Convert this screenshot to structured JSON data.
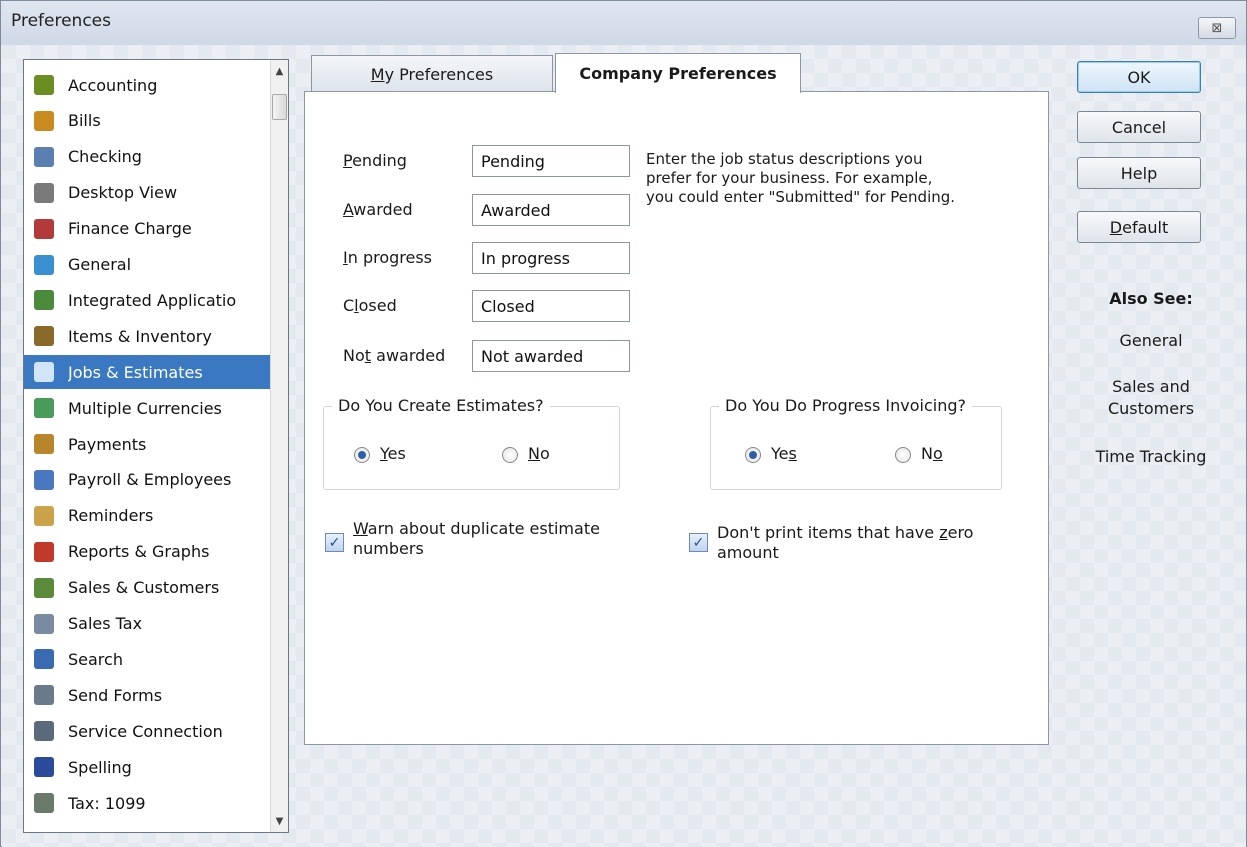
{
  "window": {
    "title": "Preferences",
    "close_glyph": "⊠"
  },
  "sidebar": {
    "items": [
      {
        "label": "Accounting",
        "icon": "accounting-icon",
        "color": "#6b8e23"
      },
      {
        "label": "Bills",
        "icon": "bills-icon",
        "color": "#c98a1e"
      },
      {
        "label": "Checking",
        "icon": "checking-icon",
        "color": "#5a7fb0"
      },
      {
        "label": "Desktop View",
        "icon": "desktop-view-icon",
        "color": "#7a7a7a"
      },
      {
        "label": "Finance Charge",
        "icon": "finance-charge-icon",
        "color": "#b33a3a"
      },
      {
        "label": "General",
        "icon": "general-icon",
        "color": "#3a8fd0"
      },
      {
        "label": "Integrated Applicatio",
        "icon": "integrated-applications-icon",
        "color": "#4a8a3a"
      },
      {
        "label": "Items & Inventory",
        "icon": "items-inventory-icon",
        "color": "#8a6a2a"
      },
      {
        "label": "Jobs & Estimates",
        "icon": "jobs-estimates-icon",
        "color": "#d2e4f7"
      },
      {
        "label": "Multiple Currencies",
        "icon": "multiple-currencies-icon",
        "color": "#4a9a5a"
      },
      {
        "label": "Payments",
        "icon": "payments-icon",
        "color": "#b8862a"
      },
      {
        "label": "Payroll & Employees",
        "icon": "payroll-employees-icon",
        "color": "#4a78c0"
      },
      {
        "label": "Reminders",
        "icon": "reminders-icon",
        "color": "#c9a24a"
      },
      {
        "label": "Reports & Graphs",
        "icon": "reports-graphs-icon",
        "color": "#c0392b"
      },
      {
        "label": "Sales & Customers",
        "icon": "sales-customers-icon",
        "color": "#5a8a3a"
      },
      {
        "label": "Sales Tax",
        "icon": "sales-tax-icon",
        "color": "#7a8aa0"
      },
      {
        "label": "Search",
        "icon": "search-icon",
        "color": "#3a6ab0"
      },
      {
        "label": "Send Forms",
        "icon": "send-forms-icon",
        "color": "#6a7a8a"
      },
      {
        "label": "Service Connection",
        "icon": "service-connection-icon",
        "color": "#5a6a7a"
      },
      {
        "label": "Spelling",
        "icon": "spelling-icon",
        "color": "#2a4a9a"
      },
      {
        "label": "Tax: 1099",
        "icon": "tax-1099-icon",
        "color": "#6a7a6a"
      }
    ],
    "selected_index": 8,
    "selected_color": "#3a78c2",
    "scroll_up": "▲",
    "scroll_down": "▼"
  },
  "tabs": {
    "my_preferences_underline": "M",
    "my_preferences_rest": "y Preferences",
    "company_preferences": "Company Preferences"
  },
  "status_fields": [
    {
      "label_pre": "",
      "label_u": "P",
      "label_post": "ending",
      "value": "Pending"
    },
    {
      "label_pre": "",
      "label_u": "A",
      "label_post": "warded",
      "value": "Awarded"
    },
    {
      "label_pre": "",
      "label_u": "I",
      "label_post": "n progress",
      "value": "In progress"
    },
    {
      "label_pre": "C",
      "label_u": "l",
      "label_post": "osed",
      "value": "Closed"
    },
    {
      "label_pre": "No",
      "label_u": "t",
      "label_post": " awarded",
      "value": "Not awarded"
    }
  ],
  "hint_lines": [
    "Enter the job status descriptions you",
    "prefer for your business.  For example,",
    "you could enter \"Submitted\" for Pending."
  ],
  "estimates_group": {
    "legend": "Do You Create Estimates?",
    "yes_u": "Y",
    "yes_rest": "es",
    "no_u": "N",
    "no_rest": "o",
    "selected": "yes"
  },
  "progress_group": {
    "legend": "Do You Do Progress Invoicing?",
    "yes_pre": "Ye",
    "yes_u": "s",
    "no_pre": "N",
    "no_u": "o",
    "selected": "yes"
  },
  "checkboxes": {
    "warn_duplicate": {
      "u": "W",
      "line1_rest": "arn about duplicate estimate",
      "line2": "numbers",
      "checked": true
    },
    "dont_print_zero": {
      "line1_pre": "Don't print items that have ",
      "u": "z",
      "line1_rest": "ero",
      "line2": "amount",
      "checked": true
    },
    "check_glyph": "✓"
  },
  "buttons": {
    "ok": "OK",
    "cancel": "Cancel",
    "help": "Help",
    "default_u": "D",
    "default_rest": "efault"
  },
  "also_see": {
    "title": "Also See:",
    "links": [
      {
        "line1": "General",
        "line2": ""
      },
      {
        "line1": "Sales and",
        "line2": "Customers"
      },
      {
        "line1": "Time Tracking",
        "line2": ""
      }
    ]
  }
}
